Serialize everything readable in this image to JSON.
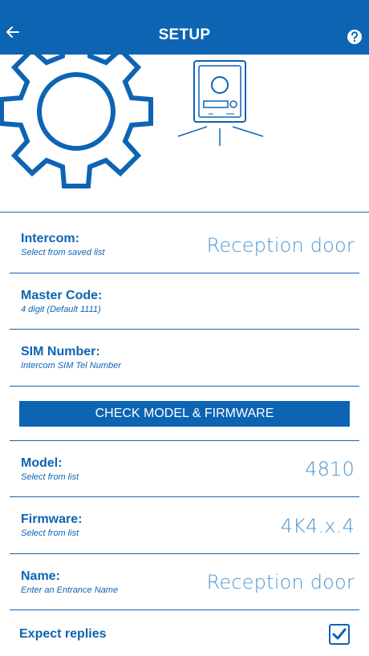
{
  "header": {
    "title": "SETUP"
  },
  "icons": {
    "back": "arrow-left-icon",
    "help": "question-circle-icon",
    "check": "checkmark-icon"
  },
  "colors": {
    "primary": "#0d64b3",
    "value_text": "#4e94d0"
  },
  "form": {
    "intercom": {
      "label": "Intercom:",
      "sub": "Select from saved list",
      "value": "Reception door"
    },
    "master_code": {
      "label": "Master Code:",
      "sub": "4 digit (Default 1111)"
    },
    "sim_number": {
      "label": "SIM Number:",
      "sub": "Intercom SIM Tel Number"
    },
    "check_button": "CHECK MODEL & FIRMWARE",
    "model": {
      "label": "Model:",
      "sub": "Select from list",
      "value": "4810"
    },
    "firmware": {
      "label": "Firmware:",
      "sub": "Select from list",
      "value": "4K4.x.4"
    },
    "name": {
      "label": "Name:",
      "sub": "Enter an Entrance Name",
      "value": "Reception door"
    },
    "expect_replies": {
      "label": "Expect replies",
      "checked": true
    }
  }
}
